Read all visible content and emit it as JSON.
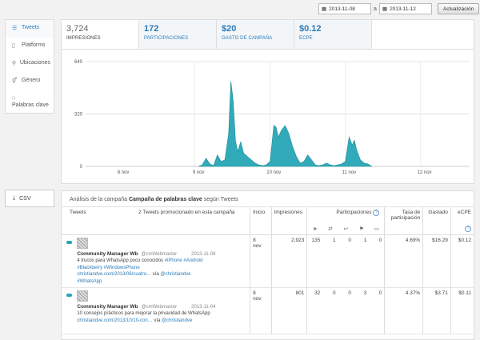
{
  "daterange": {
    "start": "2013-11-08",
    "sep": "a",
    "end": "2013-11-12",
    "update_label": "Actualización"
  },
  "sidebar": {
    "items": [
      {
        "label": "Tweets",
        "icon": "list-icon",
        "glyph": "☰",
        "active": true
      },
      {
        "label": "Platforms",
        "icon": "device-icon",
        "glyph": "▯"
      },
      {
        "label": "Ubicaciones",
        "icon": "map-pin-icon",
        "glyph": "⚲"
      },
      {
        "label": "Género",
        "icon": "gender-icon",
        "glyph": "⚥"
      },
      {
        "label": "Palabras clave",
        "icon": "tag-icon",
        "glyph": "⌂"
      }
    ],
    "csv_label": "CSV"
  },
  "tabs": [
    {
      "value": "3,724",
      "label": "IMPRESIONES"
    },
    {
      "value": "172",
      "label": "PARTICIPACIONES"
    },
    {
      "value": "$20",
      "label": "GASTO DE CAMPAÑA"
    },
    {
      "value": "$0.12",
      "label": "ECPE"
    }
  ],
  "chart_data": {
    "type": "area",
    "x_ticks": [
      "8 nov",
      "9 nov",
      "10 nov",
      "11 nov",
      "12 nov"
    ],
    "y_ticks": [
      "640",
      "320",
      "0"
    ],
    "ylim": [
      0,
      640
    ],
    "color": "#26a6b5",
    "series": [
      {
        "points": [
          [
            9.0,
            0
          ],
          [
            9.05,
            10
          ],
          [
            9.1,
            50
          ],
          [
            9.15,
            15
          ],
          [
            9.2,
            5
          ],
          [
            9.25,
            70
          ],
          [
            9.3,
            30
          ],
          [
            9.35,
            40
          ],
          [
            9.4,
            200
          ],
          [
            9.43,
            520
          ],
          [
            9.46,
            400
          ],
          [
            9.49,
            160
          ],
          [
            9.52,
            90
          ],
          [
            9.56,
            150
          ],
          [
            9.6,
            80
          ],
          [
            9.65,
            60
          ],
          [
            9.7,
            40
          ],
          [
            9.75,
            20
          ],
          [
            9.8,
            10
          ],
          [
            9.85,
            5
          ],
          [
            9.9,
            10
          ],
          [
            9.95,
            30
          ],
          [
            10.0,
            250
          ],
          [
            10.03,
            240
          ],
          [
            10.06,
            180
          ],
          [
            10.1,
            220
          ],
          [
            10.15,
            250
          ],
          [
            10.2,
            200
          ],
          [
            10.25,
            120
          ],
          [
            10.3,
            60
          ],
          [
            10.35,
            20
          ],
          [
            10.4,
            30
          ],
          [
            10.45,
            70
          ],
          [
            10.5,
            40
          ],
          [
            10.55,
            10
          ],
          [
            10.6,
            5
          ],
          [
            10.65,
            10
          ],
          [
            10.7,
            20
          ],
          [
            10.75,
            10
          ],
          [
            10.8,
            5
          ],
          [
            10.85,
            10
          ],
          [
            10.9,
            15
          ],
          [
            10.95,
            30
          ],
          [
            11.0,
            180
          ],
          [
            11.04,
            130
          ],
          [
            11.07,
            160
          ],
          [
            11.1,
            100
          ],
          [
            11.15,
            40
          ],
          [
            11.2,
            20
          ],
          [
            11.25,
            15
          ],
          [
            11.3,
            0
          ]
        ]
      }
    ]
  },
  "table": {
    "caption_prefix": "Análisis de la campaña",
    "caption_bold": "Campaña de palabras clave",
    "caption_suffix": "según Tweets",
    "headers": {
      "tweets": "Tweets",
      "promoted": "2 Tweets promocionado en esta campaña",
      "inicio": "Inicio",
      "impresiones": "Impresiones",
      "participaciones": "Participaciones",
      "participaciones_help": "?",
      "tasa": "Tasa de participación",
      "gastado": "Gastado",
      "ecpe": "eCPE",
      "ecpe_help": "?"
    },
    "engagement_icons": [
      "cursor-icon",
      "retweet-icon",
      "reply-icon",
      "follow-icon",
      "favorite-icon"
    ],
    "engagement_glyphs": [
      "➤",
      "⇄",
      "↩",
      "⚑",
      "▭"
    ],
    "rows": [
      {
        "name": "Community Manager Wb",
        "handle": "@cmWebmaster",
        "date": "2013-11-08",
        "text_plain": "4 trucos para WhatsApp poco conocidos ",
        "text_links": "#iPhone #Android #Blackberry #WindowsPhone christiandve.com/2013/06/cuatro…",
        "text_via": " vía ",
        "text_end": "@christiandve #WhatsApp",
        "inicio": "8 nov",
        "impresiones": "2,923",
        "p1": "135",
        "p2": "1",
        "p3": "0",
        "p4": "1",
        "p5": "0",
        "tasa": "4.69%",
        "gastado": "$16.29",
        "ecpe": "$0.12"
      },
      {
        "name": "Community Manager Wb",
        "handle": "@cmWebmaster",
        "date": "2013-11-04",
        "text_plain": "10 consejos prácticos para mejorar la privacidad de WhatsApp ",
        "text_links": "christiandve.com/2013/10/10-con…",
        "text_via": " vía ",
        "text_end": "@christiandve",
        "inicio": "8 nov",
        "impresiones": "801",
        "p1": "32",
        "p2": "0",
        "p3": "0",
        "p4": "3",
        "p5": "0",
        "tasa": "4.37%",
        "gastado": "$3.71",
        "ecpe": "$0.11"
      }
    ]
  }
}
